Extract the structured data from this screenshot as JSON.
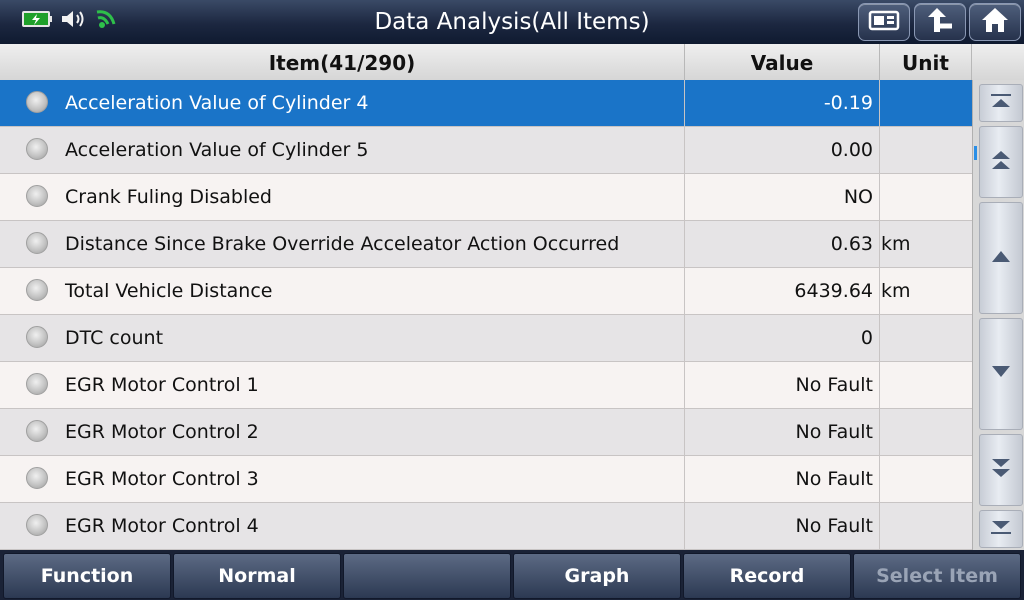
{
  "titlebar": {
    "title": "Data Analysis(All Items)",
    "buttons": [
      {
        "icon": "screenshot-icon"
      },
      {
        "icon": "back-icon"
      },
      {
        "icon": "home-icon"
      }
    ],
    "status_icons": [
      "battery-icon",
      "volume-icon",
      "wifi-icon"
    ]
  },
  "table": {
    "headers": {
      "item": "Item(41/290)",
      "value": "Value",
      "unit": "Unit"
    },
    "rows": [
      {
        "name": "Acceleration Value of Cylinder 4",
        "value": "-0.19",
        "unit": ""
      },
      {
        "name": "Acceleration Value of Cylinder 5",
        "value": "0.00",
        "unit": ""
      },
      {
        "name": "Crank Fuling Disabled",
        "value": "NO",
        "unit": ""
      },
      {
        "name": "Distance Since Brake Override Acceleator Action Occurred",
        "value": "0.63",
        "unit": "km"
      },
      {
        "name": "Total Vehicle Distance",
        "value": "6439.64",
        "unit": "km"
      },
      {
        "name": "DTC count",
        "value": "0",
        "unit": ""
      },
      {
        "name": "EGR Motor Control 1",
        "value": "No Fault",
        "unit": ""
      },
      {
        "name": "EGR Motor Control 2",
        "value": "No Fault",
        "unit": ""
      },
      {
        "name": "EGR Motor Control 3",
        "value": "No Fault",
        "unit": ""
      },
      {
        "name": "EGR Motor Control 4",
        "value": "No Fault",
        "unit": ""
      }
    ]
  },
  "bottom_bar": {
    "function": "Function",
    "normal": "Normal",
    "empty": "",
    "graph": "Graph",
    "record": "Record",
    "select_item": "Select Item"
  },
  "colors": {
    "selected_row": "#1a74c8",
    "titlebar": "#1c2740"
  }
}
